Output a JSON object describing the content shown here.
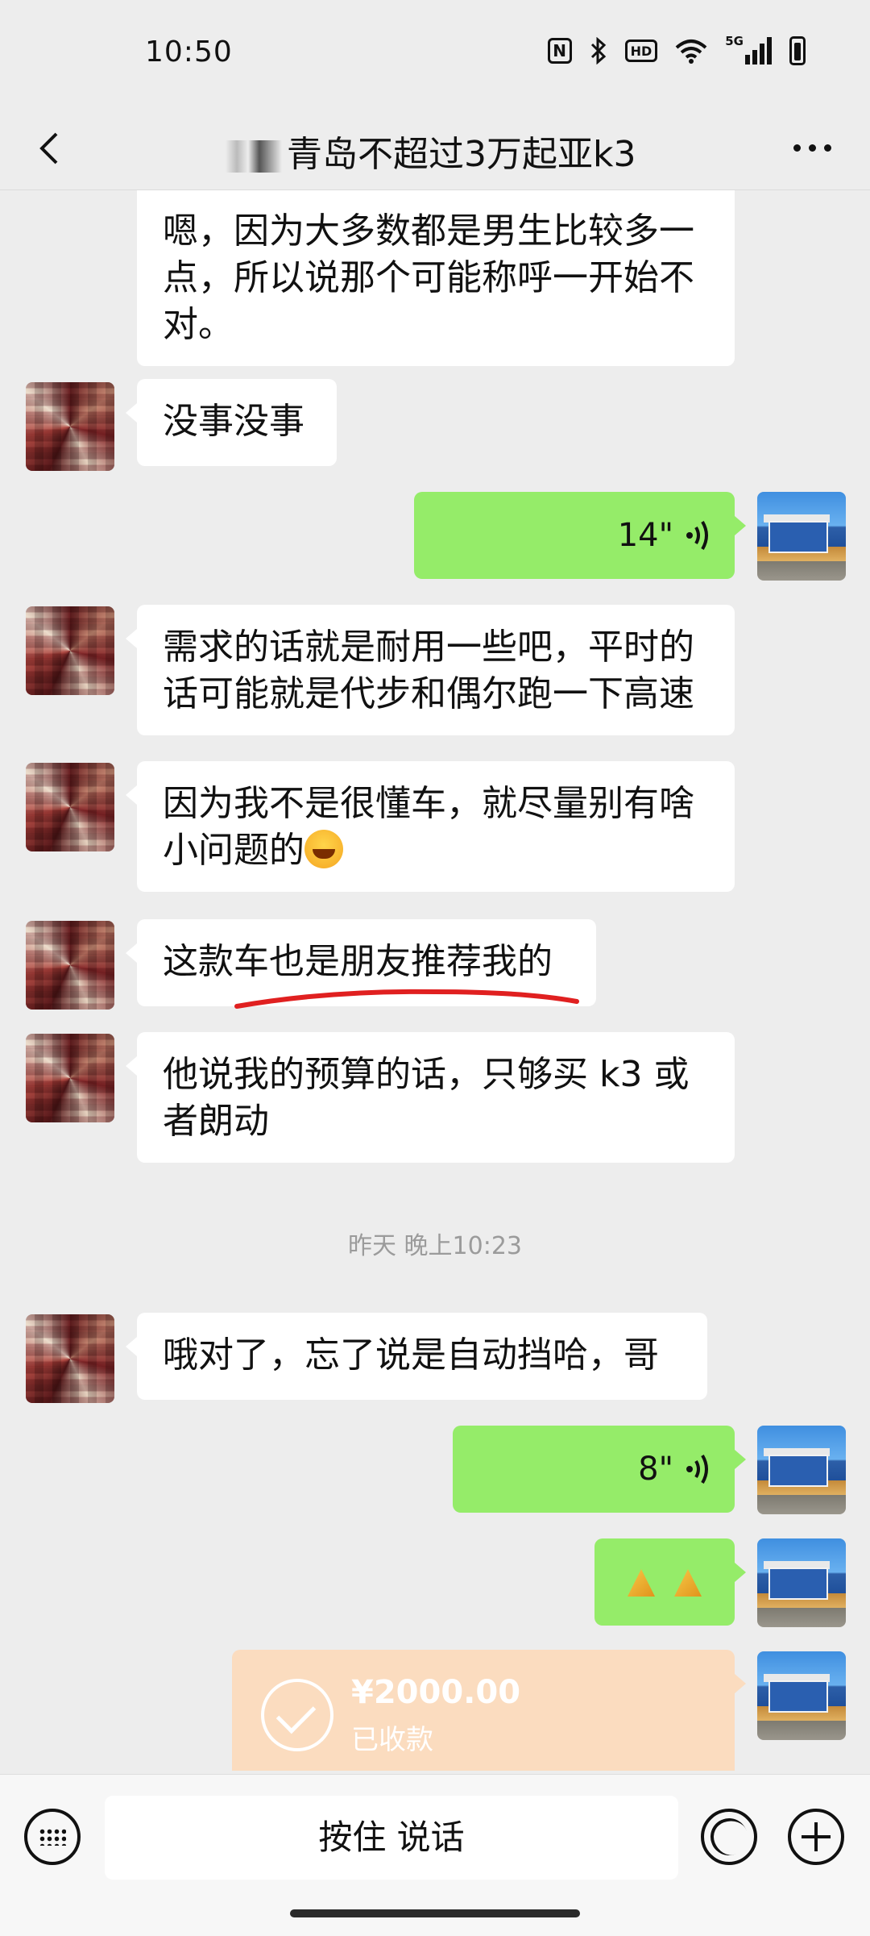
{
  "status_bar": {
    "time": "10:50",
    "network_label": "5G",
    "hd_label": "HD",
    "nfc_label": "N"
  },
  "header": {
    "title": "青岛不超过3万起亚k3"
  },
  "messages": [
    {
      "side": "in",
      "text_lines": [
        "嗯，因为大多数都是男生比较多一",
        "点，所以说那个可能称呼一开始不",
        "对。"
      ]
    },
    {
      "side": "in",
      "text": "没事没事"
    },
    {
      "side": "out",
      "type": "voice",
      "duration": "14\""
    },
    {
      "side": "in",
      "text_lines": [
        "需求的话就是耐用一些吧，平时的",
        "话可能就是代步和偶尔跑一下高速"
      ]
    },
    {
      "side": "in",
      "text_lines": [
        "因为我不是很懂车，就尽量别有啥",
        "小问题的"
      ],
      "emoji": "laughing-crying-emoji"
    },
    {
      "side": "in",
      "text": "这款车也是朋友推荐我的"
    },
    {
      "side": "in",
      "text_lines": [
        "他说我的预算的话，只够买 k3 或",
        "者朗动"
      ]
    },
    {
      "side": "in",
      "text": "哦对了，忘了说是自动挡哈，哥"
    },
    {
      "side": "out",
      "type": "voice",
      "duration": "8\""
    },
    {
      "side": "out",
      "type": "emoji",
      "emoji": "praying-hands-emoji"
    },
    {
      "side": "out",
      "type": "transfer",
      "amount": "¥2000.00",
      "status": "已收款"
    }
  ],
  "timestamp": "昨天 晚上10:23",
  "input_bar": {
    "hold_to_talk": "按住 说话"
  },
  "colors": {
    "background": "#ededed",
    "bubble_out": "#95ec69",
    "bubble_in": "#ffffff",
    "transfer_card": "#fbdcbf",
    "annotation_underline": "#e02020"
  }
}
